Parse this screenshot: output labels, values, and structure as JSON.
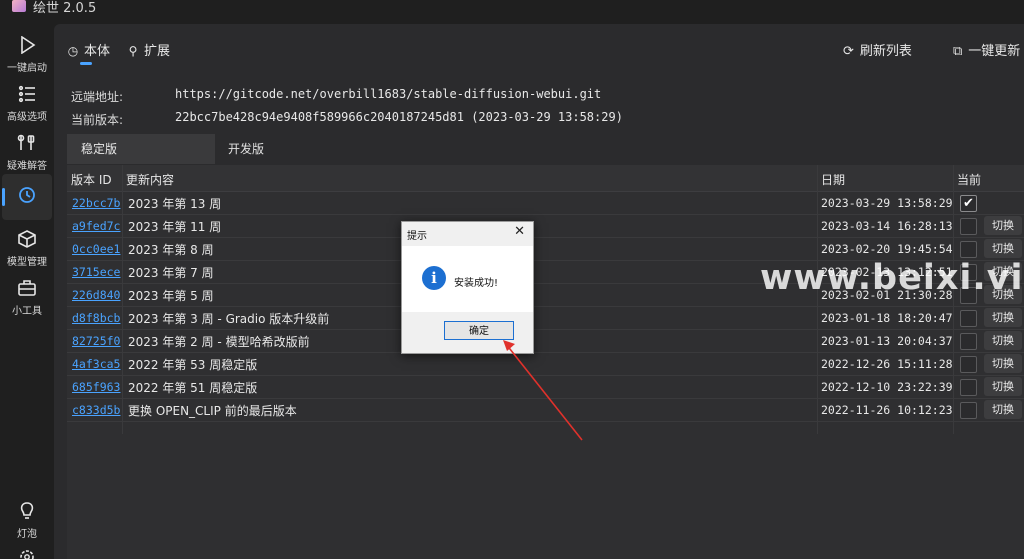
{
  "app": {
    "title": "绘世 2.0.5"
  },
  "sidebar": {
    "items": [
      {
        "label": "一键启动",
        "icon": "play-icon"
      },
      {
        "label": "高级选项",
        "icon": "list-icon"
      },
      {
        "label": "疑难解答",
        "icon": "tools-icon"
      },
      {
        "label": "",
        "icon": "history-icon",
        "active": true
      },
      {
        "label": "模型管理",
        "icon": "cube-icon"
      },
      {
        "label": "小工具",
        "icon": "toolbox-icon"
      },
      {
        "label": "灯泡",
        "icon": "bulb-icon"
      }
    ]
  },
  "tabs": [
    {
      "label": "本体"
    },
    {
      "label": "扩展"
    }
  ],
  "toolbar": {
    "refresh_label": "刷新列表",
    "update_label": "一键更新"
  },
  "info": {
    "remote_label": "远端地址:",
    "remote_value": "https://gitcode.net/overbill1683/stable-diffusion-webui.git",
    "current_label": "当前版本:",
    "current_value": "22bcc7be428c94e9408f589966c2040187245d81 (2023-03-29 13:58:29)"
  },
  "subtabs": [
    {
      "label": "稳定版"
    },
    {
      "label": "开发版"
    }
  ],
  "table": {
    "headers": {
      "id": "版本 ID",
      "desc": "更新内容",
      "date": "日期",
      "current": "当前"
    },
    "switch_label": "切换",
    "rows": [
      {
        "id": "22bcc7b",
        "desc": "2023 年第 13 周",
        "date": "2023-03-29 13:58:29",
        "current": true
      },
      {
        "id": "a9fed7c",
        "desc": "2023 年第 11 周",
        "date": "2023-03-14 16:28:13",
        "current": false
      },
      {
        "id": "0cc0ee1",
        "desc": "2023 年第 8 周",
        "date": "2023-02-20 19:45:54",
        "current": false
      },
      {
        "id": "3715ece",
        "desc": "2023 年第 7 周",
        "date": "2023-02-13 13:12:51",
        "current": false
      },
      {
        "id": "226d840",
        "desc": "2023 年第 5 周",
        "date": "2023-02-01 21:30:28",
        "current": false
      },
      {
        "id": "d8f8bcb",
        "desc": "2023 年第 3 周 - Gradio 版本升级前",
        "date": "2023-01-18 18:20:47",
        "current": false
      },
      {
        "id": "82725f0",
        "desc": "2023 年第 2 周 - 模型哈希改版前",
        "date": "2023-01-13 20:04:37",
        "current": false
      },
      {
        "id": "4af3ca5",
        "desc": "2022 年第 53 周稳定版",
        "date": "2022-12-26 15:11:28",
        "current": false
      },
      {
        "id": "685f963",
        "desc": "2022 年第 51 周稳定版",
        "date": "2022-12-10 23:22:39",
        "current": false
      },
      {
        "id": "c833d5b",
        "desc": "更换 OPEN_CLIP 前的最后版本",
        "date": "2022-11-26 10:12:23",
        "current": false
      }
    ]
  },
  "dialog": {
    "title": "提示",
    "message": "安装成功!",
    "ok_label": "确定",
    "close": "✕",
    "info_glyph": "i"
  },
  "watermark": "www.beixi.vip",
  "colors": {
    "accent": "#4aa3ff",
    "annotation_arrow": "#e0312b"
  }
}
